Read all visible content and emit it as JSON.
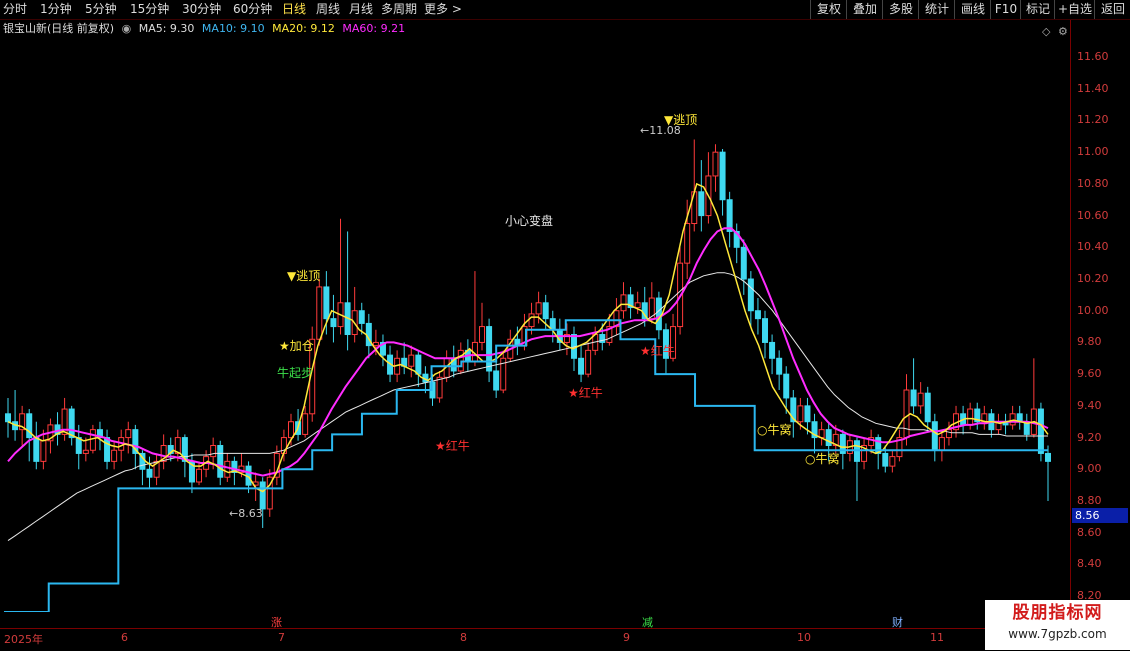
{
  "toolbar": {
    "periods": [
      "分时",
      "1分钟",
      "5分钟",
      "15分钟",
      "30分钟",
      "60分钟",
      "日线",
      "周线",
      "月线",
      "多周期",
      "更多 >"
    ],
    "active_period": "日线",
    "right_buttons": [
      "复权",
      "叠加",
      "多股",
      "统计",
      "画线",
      "F10",
      "标记",
      "+自选",
      "返回"
    ]
  },
  "info": {
    "title": "银宝山新(日线 前复权)",
    "ma5": "MA5: 9.30",
    "ma10": "MA10: 9.10",
    "ma20": "MA20: 9.12",
    "ma60": "MA60: 9.21"
  },
  "colors": {
    "up": "#ff3b3b",
    "down": "#3fd9f0",
    "ma5": "#ffe83a",
    "ma20": "#ff2cff",
    "ma60": "#e8e8e8",
    "support": "#2bb8f0",
    "axis": "#d23c3c"
  },
  "y_axis": {
    "ticks": [
      "11.60",
      "11.40",
      "11.20",
      "11.00",
      "10.80",
      "10.60",
      "10.40",
      "10.20",
      "10.00",
      "9.80",
      "9.60",
      "9.40",
      "9.20",
      "9.00",
      "8.80",
      "8.60",
      "8.40",
      "8.20"
    ],
    "current_price": "8.56"
  },
  "x_axis": {
    "labels": [
      "2025年",
      "6",
      "7",
      "8",
      "9",
      "10",
      "11"
    ]
  },
  "event_markers": [
    "涨",
    "减",
    "财"
  ],
  "annotations": {
    "high_value": "11.08",
    "low_value": "8.63",
    "escape_top": "▼逃顶",
    "escape_top_2": "▼逃顶",
    "add_position": "★加仓",
    "bull_start": "牛起步",
    "caution": "小心变盘",
    "red_bull_1": "★红牛",
    "red_bull_2": "★红牛",
    "red_bull_3": "★红牛",
    "bull_nest_1": "○牛窝",
    "bull_nest_2": "○牛窝"
  },
  "watermark": {
    "title": "股朋指标网",
    "url": "www.7gpzb.com"
  },
  "chart_data": {
    "type": "candlestick",
    "y_range": [
      8.1,
      11.72
    ],
    "candles": [
      [
        9.35,
        9.3,
        9.45,
        9.2
      ],
      [
        9.3,
        9.25,
        9.5,
        9.18
      ],
      [
        9.25,
        9.35,
        9.4,
        9.15
      ],
      [
        9.35,
        9.2,
        9.38,
        9.05
      ],
      [
        9.2,
        9.05,
        9.3,
        9.0
      ],
      [
        9.05,
        9.18,
        9.25,
        9.0
      ],
      [
        9.18,
        9.28,
        9.32,
        9.1
      ],
      [
        9.28,
        9.22,
        9.36,
        9.15
      ],
      [
        9.22,
        9.38,
        9.45,
        9.18
      ],
      [
        9.38,
        9.2,
        9.4,
        9.15
      ],
      [
        9.2,
        9.1,
        9.28,
        9.0
      ],
      [
        9.1,
        9.12,
        9.2,
        9.05
      ],
      [
        9.12,
        9.25,
        9.28,
        9.1
      ],
      [
        9.25,
        9.2,
        9.3,
        9.12
      ],
      [
        9.2,
        9.05,
        9.25,
        9.0
      ],
      [
        9.05,
        9.12,
        9.18,
        9.0
      ],
      [
        9.12,
        9.2,
        9.25,
        9.05
      ],
      [
        9.2,
        9.25,
        9.3,
        9.1
      ],
      [
        9.25,
        9.1,
        9.28,
        9.0
      ],
      [
        9.1,
        9.0,
        9.12,
        8.9
      ],
      [
        9.0,
        8.95,
        9.08,
        8.88
      ],
      [
        8.95,
        9.05,
        9.1,
        8.9
      ],
      [
        9.05,
        9.15,
        9.22,
        9.0
      ],
      [
        9.15,
        9.1,
        9.2,
        9.05
      ],
      [
        9.1,
        9.2,
        9.25,
        9.05
      ],
      [
        9.2,
        9.05,
        9.22,
        8.95
      ],
      [
        9.05,
        8.92,
        9.1,
        8.85
      ],
      [
        8.92,
        9.0,
        9.05,
        8.9
      ],
      [
        9.0,
        9.08,
        9.12,
        8.95
      ],
      [
        9.08,
        9.15,
        9.2,
        9.0
      ],
      [
        9.15,
        8.95,
        9.18,
        8.9
      ],
      [
        8.95,
        9.05,
        9.1,
        8.92
      ],
      [
        9.05,
        8.98,
        9.08,
        8.9
      ],
      [
        8.98,
        9.02,
        9.1,
        8.95
      ],
      [
        9.02,
        8.9,
        9.05,
        8.85
      ],
      [
        8.9,
        8.92,
        8.98,
        8.8
      ],
      [
        8.92,
        8.75,
        8.95,
        8.63
      ],
      [
        8.75,
        8.95,
        9.0,
        8.7
      ],
      [
        8.95,
        9.1,
        9.15,
        8.9
      ],
      [
        9.1,
        9.2,
        9.25,
        9.05
      ],
      [
        9.2,
        9.3,
        9.35,
        9.15
      ],
      [
        9.3,
        9.22,
        9.38,
        9.18
      ],
      [
        9.22,
        9.35,
        9.4,
        9.2
      ],
      [
        9.35,
        9.82,
        9.9,
        9.3
      ],
      [
        9.82,
        10.15,
        10.2,
        9.78
      ],
      [
        10.15,
        9.95,
        10.25,
        9.85
      ],
      [
        9.95,
        9.9,
        10.1,
        9.8
      ],
      [
        9.9,
        10.05,
        10.58,
        9.85
      ],
      [
        10.05,
        9.85,
        10.5,
        9.75
      ],
      [
        9.85,
        10.0,
        10.15,
        9.8
      ],
      [
        10.0,
        9.92,
        10.05,
        9.85
      ],
      [
        9.92,
        9.78,
        9.98,
        9.7
      ],
      [
        9.78,
        9.8,
        9.88,
        9.72
      ],
      [
        9.8,
        9.72,
        9.85,
        9.65
      ],
      [
        9.72,
        9.6,
        9.78,
        9.55
      ],
      [
        9.6,
        9.7,
        9.75,
        9.55
      ],
      [
        9.7,
        9.65,
        9.8,
        9.6
      ],
      [
        9.65,
        9.72,
        9.78,
        9.58
      ],
      [
        9.72,
        9.6,
        9.75,
        9.52
      ],
      [
        9.6,
        9.55,
        9.65,
        9.48
      ],
      [
        9.55,
        9.45,
        9.6,
        9.4
      ],
      [
        9.45,
        9.58,
        9.62,
        9.42
      ],
      [
        9.58,
        9.7,
        9.75,
        9.55
      ],
      [
        9.7,
        9.62,
        9.78,
        9.58
      ],
      [
        9.62,
        9.75,
        9.8,
        9.6
      ],
      [
        9.75,
        9.68,
        9.82,
        9.62
      ],
      [
        9.68,
        9.8,
        10.25,
        9.65
      ],
      [
        9.8,
        9.9,
        10.05,
        9.75
      ],
      [
        9.9,
        9.62,
        9.95,
        9.55
      ],
      [
        9.62,
        9.5,
        9.68,
        9.45
      ],
      [
        9.5,
        9.7,
        9.75,
        9.48
      ],
      [
        9.7,
        9.82,
        9.88,
        9.68
      ],
      [
        9.82,
        9.78,
        9.9,
        9.72
      ],
      [
        9.78,
        9.9,
        9.98,
        9.75
      ],
      [
        9.9,
        9.98,
        10.05,
        9.85
      ],
      [
        9.98,
        10.05,
        10.12,
        9.92
      ],
      [
        10.05,
        9.95,
        10.1,
        9.88
      ],
      [
        9.95,
        9.88,
        10.0,
        9.8
      ],
      [
        9.88,
        9.8,
        9.95,
        9.75
      ],
      [
        9.8,
        9.85,
        9.92,
        9.72
      ],
      [
        9.85,
        9.7,
        9.9,
        9.62
      ],
      [
        9.7,
        9.6,
        9.78,
        9.55
      ],
      [
        9.6,
        9.75,
        9.8,
        9.58
      ],
      [
        9.75,
        9.85,
        9.9,
        9.72
      ],
      [
        9.85,
        9.8,
        9.92,
        9.75
      ],
      [
        9.8,
        9.9,
        9.98,
        9.78
      ],
      [
        9.9,
        10.0,
        10.08,
        9.85
      ],
      [
        10.0,
        10.1,
        10.18,
        9.95
      ],
      [
        10.1,
        10.02,
        10.15,
        9.95
      ],
      [
        10.02,
        10.05,
        10.12,
        9.98
      ],
      [
        10.05,
        9.95,
        10.15,
        9.9
      ],
      [
        9.95,
        10.08,
        10.18,
        9.92
      ],
      [
        10.08,
        9.88,
        10.12,
        9.82
      ],
      [
        9.88,
        9.7,
        9.92,
        9.6
      ],
      [
        9.7,
        9.9,
        9.98,
        9.68
      ],
      [
        9.9,
        10.3,
        10.4,
        9.85
      ],
      [
        10.3,
        10.55,
        10.7,
        10.2
      ],
      [
        10.55,
        10.75,
        11.08,
        10.5
      ],
      [
        10.75,
        10.6,
        10.95,
        10.5
      ],
      [
        10.6,
        10.85,
        11.0,
        10.55
      ],
      [
        10.85,
        11.0,
        11.05,
        10.75
      ],
      [
        11.0,
        10.7,
        11.02,
        10.6
      ],
      [
        10.7,
        10.5,
        10.75,
        10.4
      ],
      [
        10.5,
        10.4,
        10.55,
        10.3
      ],
      [
        10.4,
        10.2,
        10.45,
        10.1
      ],
      [
        10.2,
        10.0,
        10.25,
        9.9
      ],
      [
        10.0,
        9.95,
        10.08,
        9.85
      ],
      [
        9.95,
        9.8,
        10.0,
        9.7
      ],
      [
        9.8,
        9.7,
        9.85,
        9.6
      ],
      [
        9.7,
        9.6,
        9.75,
        9.5
      ],
      [
        9.6,
        9.45,
        9.65,
        9.35
      ],
      [
        9.45,
        9.3,
        9.5,
        9.2
      ],
      [
        9.3,
        9.4,
        9.45,
        9.25
      ],
      [
        9.4,
        9.3,
        9.45,
        9.22
      ],
      [
        9.3,
        9.2,
        9.35,
        9.1
      ],
      [
        9.2,
        9.25,
        9.3,
        9.15
      ],
      [
        9.25,
        9.15,
        9.3,
        9.05
      ],
      [
        9.15,
        9.22,
        9.28,
        9.1
      ],
      [
        9.22,
        9.1,
        9.25,
        9.0
      ],
      [
        9.1,
        9.18,
        9.22,
        9.05
      ],
      [
        9.18,
        9.05,
        9.2,
        8.8
      ],
      [
        9.05,
        9.15,
        9.2,
        9.0
      ],
      [
        9.15,
        9.2,
        9.25,
        9.1
      ],
      [
        9.2,
        9.1,
        9.22,
        9.0
      ],
      [
        9.1,
        9.02,
        9.15,
        8.98
      ],
      [
        9.02,
        9.08,
        9.12,
        8.98
      ],
      [
        9.08,
        9.2,
        9.25,
        9.05
      ],
      [
        9.2,
        9.5,
        9.6,
        9.15
      ],
      [
        9.5,
        9.4,
        9.7,
        9.35
      ],
      [
        9.4,
        9.48,
        9.55,
        9.35
      ],
      [
        9.48,
        9.3,
        9.52,
        9.25
      ],
      [
        9.3,
        9.12,
        9.35,
        9.05
      ],
      [
        9.12,
        9.2,
        9.25,
        9.05
      ],
      [
        9.2,
        9.25,
        9.3,
        9.15
      ],
      [
        9.25,
        9.35,
        9.4,
        9.2
      ],
      [
        9.35,
        9.28,
        9.4,
        9.22
      ],
      [
        9.28,
        9.38,
        9.42,
        9.25
      ],
      [
        9.38,
        9.3,
        9.42,
        9.25
      ],
      [
        9.3,
        9.35,
        9.4,
        9.25
      ],
      [
        9.35,
        9.25,
        9.38,
        9.2
      ],
      [
        9.25,
        9.3,
        9.35,
        9.22
      ],
      [
        9.3,
        9.28,
        9.35,
        9.22
      ],
      [
        9.28,
        9.35,
        9.4,
        9.25
      ],
      [
        9.35,
        9.3,
        9.4,
        9.25
      ],
      [
        9.3,
        9.22,
        9.35,
        9.18
      ],
      [
        9.22,
        9.38,
        9.7,
        9.2
      ],
      [
        9.38,
        9.1,
        9.42,
        9.05
      ],
      [
        9.1,
        9.05,
        9.15,
        8.8
      ]
    ],
    "ma5": [
      9.3,
      9.28,
      9.27,
      9.24,
      9.2,
      9.18,
      9.19,
      9.22,
      9.24,
      9.22,
      9.2,
      9.18,
      9.19,
      9.2,
      9.17,
      9.15,
      9.14,
      9.16,
      9.15,
      9.1,
      9.05,
      9.02,
      9.05,
      9.08,
      9.12,
      9.1,
      9.05,
      9.02,
      9.02,
      9.05,
      9.03,
      9.0,
      8.98,
      8.99,
      8.97,
      8.95,
      8.88,
      8.86,
      8.9,
      8.98,
      9.1,
      9.18,
      9.25,
      9.4,
      9.6,
      9.78,
      9.9,
      10.0,
      9.98,
      9.96,
      9.94,
      9.88,
      9.85,
      9.78,
      9.72,
      9.68,
      9.65,
      9.66,
      9.64,
      9.62,
      9.58,
      9.56,
      9.6,
      9.62,
      9.66,
      9.7,
      9.72,
      9.76,
      9.72,
      9.68,
      9.68,
      9.7,
      9.74,
      9.8,
      9.86,
      9.92,
      9.96,
      9.96,
      9.92,
      9.88,
      9.82,
      9.78,
      9.76,
      9.78,
      9.8,
      9.84,
      9.88,
      9.94,
      10.0,
      10.04,
      10.04,
      10.02,
      10.0,
      9.94,
      9.92,
      9.98,
      10.1,
      10.3,
      10.5,
      10.65,
      10.8,
      10.78,
      10.7,
      10.6,
      10.45,
      10.3,
      10.15,
      10.0,
      9.88,
      9.78,
      9.65,
      9.52,
      9.45,
      9.38,
      9.32,
      9.28,
      9.25,
      9.22,
      9.2,
      9.18,
      9.16,
      9.14,
      9.14,
      9.15,
      9.14,
      9.12,
      9.1,
      9.12,
      9.18,
      9.25,
      9.32,
      9.35,
      9.33,
      9.28,
      9.25,
      9.22,
      9.24,
      9.28,
      9.3,
      9.32,
      9.32,
      9.31,
      9.3,
      9.3,
      9.29,
      9.3,
      9.31,
      9.3,
      9.29,
      9.3,
      9.28,
      9.22
    ],
    "ma20": [
      9.05,
      9.1,
      9.14,
      9.18,
      9.2,
      9.22,
      9.23,
      9.24,
      9.25,
      9.25,
      9.24,
      9.23,
      9.22,
      9.21,
      9.2,
      9.18,
      9.17,
      9.16,
      9.15,
      9.14,
      9.12,
      9.1,
      9.09,
      9.08,
      9.08,
      9.07,
      9.06,
      9.05,
      9.04,
      9.04,
      9.03,
      9.02,
      9.01,
      9.0,
      8.99,
      8.98,
      8.97,
      8.96,
      8.97,
      8.98,
      9.0,
      9.02,
      9.05,
      9.1,
      9.16,
      9.22,
      9.3,
      9.38,
      9.45,
      9.52,
      9.58,
      9.64,
      9.7,
      9.74,
      9.78,
      9.8,
      9.8,
      9.79,
      9.78,
      9.76,
      9.74,
      9.72,
      9.7,
      9.7,
      9.7,
      9.7,
      9.71,
      9.72,
      9.72,
      9.72,
      9.72,
      9.73,
      9.74,
      9.76,
      9.78,
      9.8,
      9.82,
      9.83,
      9.84,
      9.84,
      9.84,
      9.84,
      9.84,
      9.84,
      9.85,
      9.86,
      9.87,
      9.88,
      9.9,
      9.92,
      9.93,
      9.94,
      9.94,
      9.94,
      9.95,
      9.97,
      10.0,
      10.05,
      10.12,
      10.2,
      10.3,
      10.38,
      10.45,
      10.5,
      10.52,
      10.52,
      10.48,
      10.42,
      10.34,
      10.26,
      10.16,
      10.05,
      9.94,
      9.82,
      9.7,
      9.6,
      9.5,
      9.42,
      9.35,
      9.3,
      9.26,
      9.24,
      9.22,
      9.21,
      9.2,
      9.19,
      9.18,
      9.17,
      9.17,
      9.18,
      9.19,
      9.21,
      9.22,
      9.23,
      9.24,
      9.24,
      9.25,
      9.26,
      9.27,
      9.28,
      9.28,
      9.29,
      9.29,
      9.3,
      9.3,
      9.3,
      9.3,
      9.3,
      9.3,
      9.29,
      9.28,
      9.26
    ],
    "ma60": [
      8.55,
      8.58,
      8.61,
      8.64,
      8.67,
      8.7,
      8.73,
      8.76,
      8.79,
      8.82,
      8.85,
      8.87,
      8.89,
      8.91,
      8.93,
      8.95,
      8.97,
      8.99,
      9.0,
      9.02,
      9.03,
      9.04,
      9.05,
      9.06,
      9.07,
      9.08,
      9.08,
      9.09,
      9.09,
      9.09,
      9.1,
      9.1,
      9.1,
      9.1,
      9.1,
      9.1,
      9.1,
      9.1,
      9.1,
      9.11,
      9.12,
      9.14,
      9.16,
      9.18,
      9.21,
      9.24,
      9.27,
      9.3,
      9.33,
      9.36,
      9.38,
      9.4,
      9.42,
      9.44,
      9.46,
      9.48,
      9.5,
      9.51,
      9.52,
      9.53,
      9.54,
      9.55,
      9.56,
      9.57,
      9.58,
      9.6,
      9.61,
      9.62,
      9.63,
      9.64,
      9.65,
      9.66,
      9.67,
      9.68,
      9.69,
      9.7,
      9.71,
      9.72,
      9.73,
      9.74,
      9.75,
      9.76,
      9.77,
      9.78,
      9.79,
      9.8,
      9.81,
      9.82,
      9.84,
      9.86,
      9.88,
      9.9,
      9.92,
      9.95,
      9.98,
      10.02,
      10.06,
      10.1,
      10.14,
      10.18,
      10.2,
      10.22,
      10.23,
      10.24,
      10.24,
      10.23,
      10.21,
      10.18,
      10.14,
      10.1,
      10.05,
      10.0,
      9.94,
      9.88,
      9.82,
      9.76,
      9.7,
      9.64,
      9.58,
      9.52,
      9.47,
      9.43,
      9.39,
      9.36,
      9.33,
      9.31,
      9.29,
      9.28,
      9.27,
      9.26,
      9.26,
      9.25,
      9.25,
      9.25,
      9.24,
      9.24,
      9.24,
      9.23,
      9.23,
      9.23,
      9.23,
      9.22,
      9.22,
      9.22,
      9.22,
      9.21,
      9.21,
      9.21,
      9.21,
      9.21,
      9.21,
      9.21
    ],
    "support_steps": [
      [
        0,
        8.1
      ],
      [
        18,
        8.28
      ],
      [
        46,
        8.88
      ],
      [
        112,
        9.0
      ],
      [
        124,
        9.12
      ],
      [
        132,
        9.22
      ],
      [
        144,
        9.35
      ],
      [
        158,
        9.5
      ],
      [
        172,
        9.65
      ],
      [
        184,
        9.68
      ],
      [
        198,
        9.78
      ],
      [
        210,
        9.88
      ],
      [
        226,
        9.94
      ],
      [
        248,
        9.82
      ],
      [
        262,
        9.6
      ],
      [
        278,
        9.4
      ],
      [
        302,
        9.12
      ],
      [
        420,
        9.12
      ]
    ]
  }
}
